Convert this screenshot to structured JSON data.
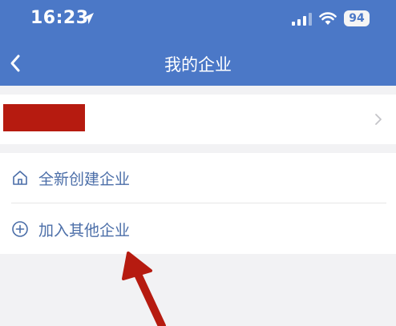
{
  "status_bar": {
    "time": "16:23",
    "battery": "94"
  },
  "nav": {
    "title": "我的企业"
  },
  "enterprise": {
    "name_redacted": true
  },
  "actions": [
    {
      "label": "全新创建企业",
      "icon": "home-icon"
    },
    {
      "label": "加入其他企业",
      "icon": "plus-circle-icon"
    }
  ],
  "colors": {
    "header": "#4b78c7",
    "accent_text": "#4b6ea8",
    "annotation": "#b61b10",
    "background": "#f2f2f4"
  }
}
